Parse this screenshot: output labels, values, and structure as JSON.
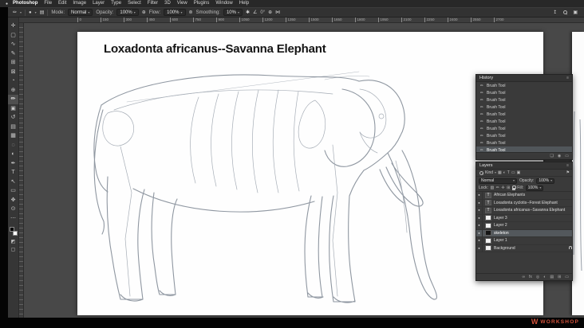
{
  "icons": {
    "apple": "●",
    "caret_down": "▾",
    "panel_menu": "≡",
    "brush_tool": "✏",
    "brush_preview": "●",
    "brush_panel_toggle": "▤",
    "pressure": "⊕",
    "airbrush": "⊚",
    "smoothing_gear": "✱",
    "angle": "∠",
    "symmetry": "⋈",
    "share": "↥",
    "workspace": "▣",
    "brush_state": "✏",
    "type_badge": "T",
    "eye": "●",
    "flag": "⚑",
    "filter_pixel": "▦",
    "filter_adjust": "◐",
    "filter_type": "T",
    "filter_shape": "▭",
    "filter_smart": "▣",
    "lock_transparent": "▨",
    "lock_pixels": "✏",
    "lock_position": "✛",
    "lock_artboard": "⊞",
    "link": "∞",
    "fx": "fx",
    "mask": "◎",
    "adjust": "◐",
    "group": "▤",
    "new_layer": "⊞",
    "delete": "▭",
    "new_doc_from_state": "❏",
    "snapshot_camera": "◉"
  },
  "menubar": {
    "items": [
      {
        "label": "Photoshop",
        "bold": true
      },
      {
        "label": "File"
      },
      {
        "label": "Edit"
      },
      {
        "label": "Image"
      },
      {
        "label": "Layer"
      },
      {
        "label": "Type"
      },
      {
        "label": "Select"
      },
      {
        "label": "Filter"
      },
      {
        "label": "3D"
      },
      {
        "label": "View"
      },
      {
        "label": "Plugins"
      },
      {
        "label": "Window"
      },
      {
        "label": "Help"
      }
    ]
  },
  "options_bar": {
    "mode_label": "Mode:",
    "mode_value": "Normal",
    "opacity_label": "Opacity:",
    "opacity_value": "100%",
    "flow_label": "Flow:",
    "flow_value": "100%",
    "smoothing_label": "Smoothing:",
    "smoothing_value": "10%",
    "angle_value": "0°"
  },
  "toolbar": {
    "tools": [
      {
        "name": "move-tool",
        "glyph": "✛"
      },
      {
        "name": "rectangular-marquee-tool",
        "glyph": "▢"
      },
      {
        "name": "lasso-tool",
        "glyph": "∿"
      },
      {
        "name": "quick-selection-tool",
        "glyph": "✎"
      },
      {
        "name": "crop-tool",
        "glyph": "⊞"
      },
      {
        "name": "frame-tool",
        "glyph": "⊠"
      },
      {
        "name": "eyedropper-tool",
        "glyph": "◔"
      },
      {
        "name": "spot-healing-tool",
        "glyph": "⊕"
      },
      {
        "name": "brush-tool",
        "glyph": "✏",
        "active": true
      },
      {
        "name": "clone-stamp-tool",
        "glyph": "▣"
      },
      {
        "name": "history-brush-tool",
        "glyph": "↺"
      },
      {
        "name": "eraser-tool",
        "glyph": "▤"
      },
      {
        "name": "gradient-tool",
        "glyph": "▦"
      },
      {
        "name": "blur-tool",
        "glyph": "◌"
      },
      {
        "name": "dodge-tool",
        "glyph": "◐"
      },
      {
        "name": "pen-tool",
        "glyph": "✒"
      },
      {
        "name": "type-tool",
        "glyph": "T"
      },
      {
        "name": "path-selection-tool",
        "glyph": "↖"
      },
      {
        "name": "shape-tool",
        "glyph": "▭"
      },
      {
        "name": "hand-tool",
        "glyph": "✥"
      },
      {
        "name": "zoom-tool",
        "glyph": "⊙"
      },
      {
        "name": "edit-toolbar",
        "glyph": "⋯"
      }
    ]
  },
  "ruler": {
    "ticks": [
      "0",
      "150",
      "300",
      "450",
      "600",
      "750",
      "900",
      "1050",
      "1200",
      "1350",
      "1500",
      "1650",
      "1800",
      "1950",
      "2100",
      "2250",
      "2400",
      "2550",
      "2700"
    ]
  },
  "document": {
    "title_text": "Loxadonta africanus--Savanna Elephant"
  },
  "history_panel": {
    "title": "History",
    "entries": [
      {
        "label": "Brush Tool"
      },
      {
        "label": "Brush Tool"
      },
      {
        "label": "Brush Tool"
      },
      {
        "label": "Brush Tool"
      },
      {
        "label": "Brush Tool"
      },
      {
        "label": "Brush Tool"
      },
      {
        "label": "Brush Tool"
      },
      {
        "label": "Brush Tool"
      },
      {
        "label": "Brush Tool"
      },
      {
        "label": "Brush Tool",
        "selected": true
      }
    ]
  },
  "layers_panel": {
    "title": "Layers",
    "kind_label": "Kind",
    "blend_mode": "Normal",
    "opacity_label": "Opacity:",
    "opacity_value": "100%",
    "lock_label": "Lock:",
    "fill_label": "Fill:",
    "fill_value": "100%",
    "layers": [
      {
        "name": "African Elephants",
        "is_text": true
      },
      {
        "name": "Loxadonta cyclotis--Forest Elephant",
        "is_text": true
      },
      {
        "name": "Loxadonta africanus--Savanna Elephant",
        "is_text": true
      },
      {
        "name": "Layer 3"
      },
      {
        "name": "Layer 2"
      },
      {
        "name": "skeleton",
        "selected": true,
        "thumb_dark": true
      },
      {
        "name": "Layer 1"
      },
      {
        "name": "Background",
        "locked": true
      }
    ]
  },
  "watermark": {
    "logo_letter": "W",
    "text": "WORKSHOP"
  }
}
